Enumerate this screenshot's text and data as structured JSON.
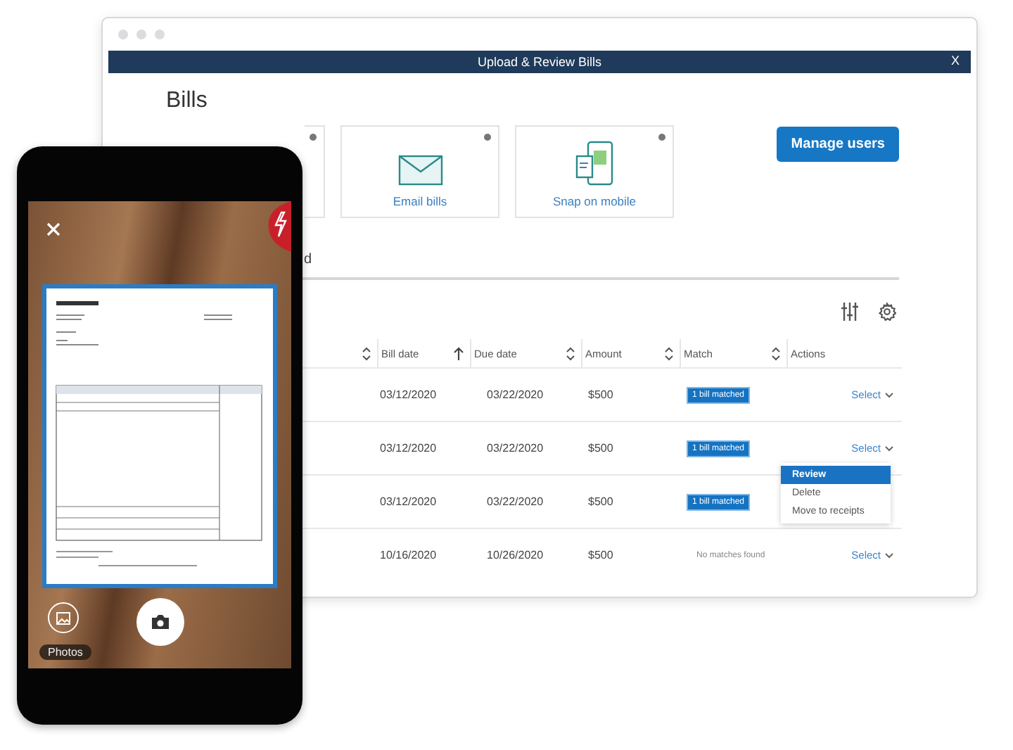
{
  "window": {
    "title": "Upload & Review Bills",
    "close": "X"
  },
  "page_title": "Bills",
  "upload_options": [
    {
      "kind": "blank"
    },
    {
      "kind": "email",
      "label": "Email bills"
    },
    {
      "kind": "mobile",
      "label": "Snap on mobile"
    }
  ],
  "manage_button": "Manage users",
  "tab_fragment": "d",
  "table": {
    "columns": [
      {
        "sortable": true,
        "sorted_ascending": false
      },
      {
        "label": "Bill date",
        "sortable": true,
        "sorted_ascending": true
      },
      {
        "label": "Due date",
        "sortable": true,
        "sorted_ascending": false
      },
      {
        "label": "Amount",
        "sortable": true,
        "sorted_ascending": false
      },
      {
        "label": "Match",
        "sortable": true,
        "sorted_ascending": false
      },
      {
        "label": "Actions",
        "sortable": false
      }
    ],
    "rows": [
      {
        "bill_date": "03/12/2020",
        "due_date": "03/22/2020",
        "amount": "$500",
        "match": "1 bill matched",
        "matched": true,
        "action": "Select"
      },
      {
        "bill_date": "03/12/2020",
        "due_date": "03/22/2020",
        "amount": "$500",
        "match": "1 bill matched",
        "matched": true,
        "action": "Select"
      },
      {
        "bill_date": "03/12/2020",
        "due_date": "03/22/2020",
        "amount": "$500",
        "match": "1 bill matched",
        "matched": true
      },
      {
        "bill_date": "10/16/2020",
        "due_date": "10/26/2020",
        "amount": "$500",
        "match": "No matches found",
        "matched": false,
        "action": "Select"
      }
    ]
  },
  "action_menu": [
    {
      "label": "Review",
      "selected": true
    },
    {
      "label": "Delete",
      "selected": false
    },
    {
      "label": "Move to receipts",
      "selected": false
    }
  ],
  "phone": {
    "photos_label": "Photos"
  }
}
